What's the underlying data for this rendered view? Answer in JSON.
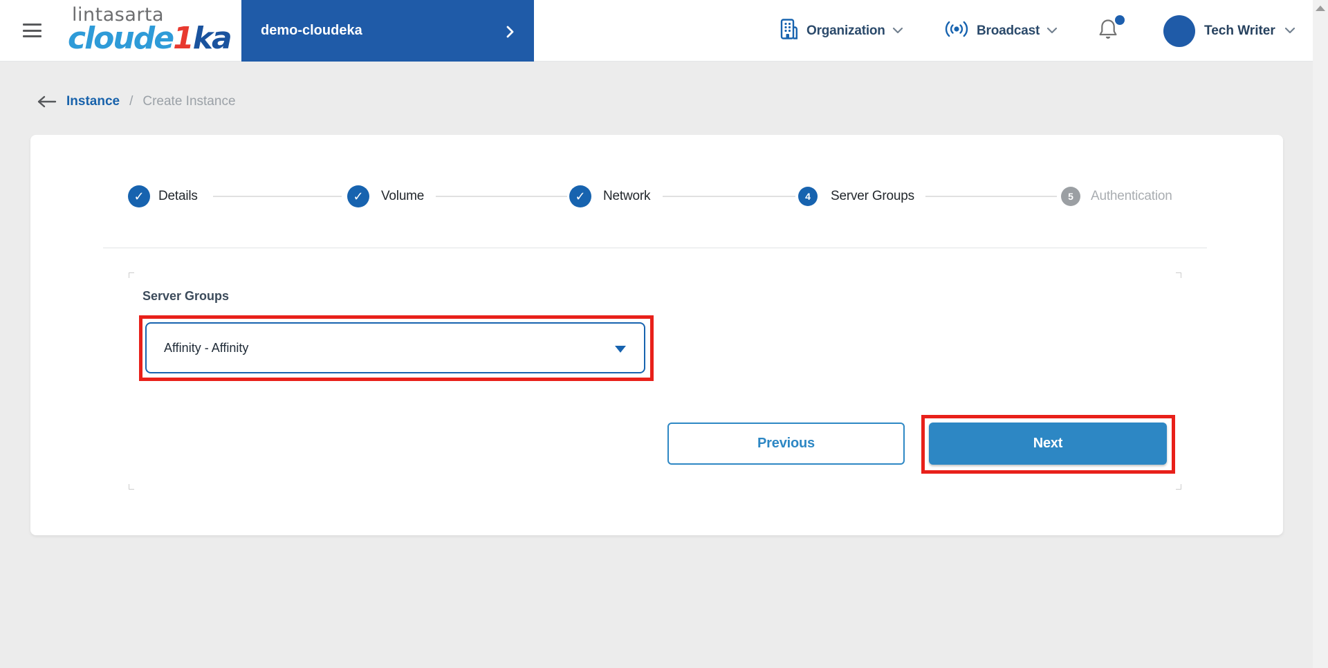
{
  "colors": {
    "header_blue": "#1f5ba8",
    "accent_blue": "#1763af",
    "button_blue": "#2d87c4",
    "annotation_red": "#e8201a",
    "brand_light_blue": "#2e9bd8",
    "brand_dark_blue": "#1a539e",
    "brand_red": "#e8392f"
  },
  "header": {
    "logo_top": "lintasarta",
    "logo_brand": {
      "pre": "cloude",
      "accent": "1",
      "post": "ka"
    },
    "project": {
      "name": "demo-cloudeka"
    },
    "nav": {
      "organization_label": "Organization",
      "broadcast_label": "Broadcast",
      "user_name": "Tech Writer"
    }
  },
  "breadcrumb": {
    "parent": "Instance",
    "separator": "/",
    "current": "Create Instance"
  },
  "stepper": {
    "check_glyph": "✓",
    "steps": [
      {
        "label": "Details",
        "state": "done"
      },
      {
        "label": "Volume",
        "state": "done"
      },
      {
        "label": "Network",
        "state": "done"
      },
      {
        "label": "Server Groups",
        "state": "active",
        "number": "4"
      },
      {
        "label": "Authentication",
        "state": "pending",
        "number": "5"
      }
    ]
  },
  "form": {
    "server_groups_label": "Server Groups",
    "server_groups_value": "Affinity - Affinity"
  },
  "actions": {
    "previous_label": "Previous",
    "next_label": "Next"
  }
}
